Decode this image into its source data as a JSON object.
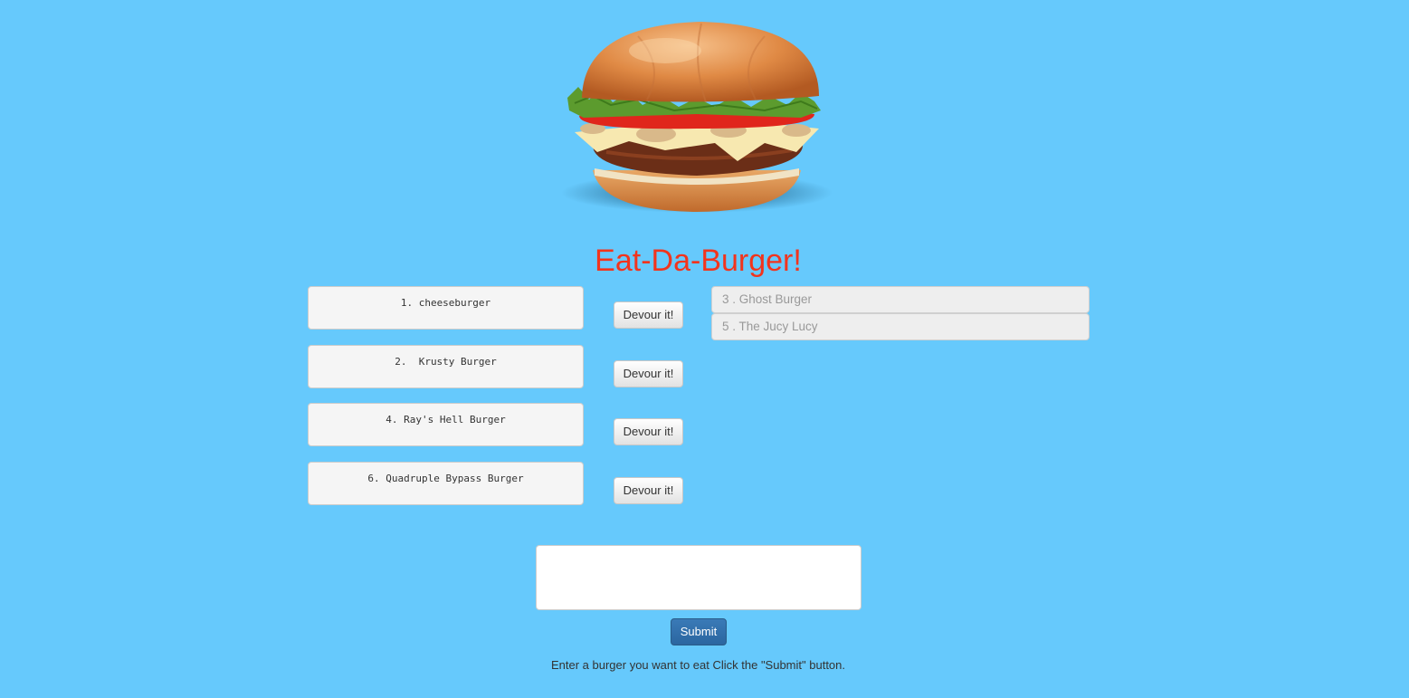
{
  "app": {
    "title": "Eat-Da-Burger!",
    "hero_image": "hamburger-photo",
    "colors": {
      "background": "#66c9fc",
      "title": "#f2341d",
      "submit_button": "#2b66a0"
    }
  },
  "uneaten_burgers": [
    {
      "label": "1. cheeseburger",
      "button_label": "Devour it!"
    },
    {
      "label": "2.  Krusty Burger",
      "button_label": "Devour it!"
    },
    {
      "label": "4. Ray's Hell Burger",
      "button_label": "Devour it!"
    },
    {
      "label": "6. Quadruple Bypass Burger",
      "button_label": "Devour it!"
    }
  ],
  "devoured_burgers": [
    {
      "label": "3 .  Ghost Burger"
    },
    {
      "label": "5 .  The Jucy Lucy"
    }
  ],
  "form": {
    "input_value": "",
    "input_placeholder": "",
    "submit_label": "Submit",
    "helper_text": "Enter a burger you want to eat Click the \"Submit\" button."
  }
}
